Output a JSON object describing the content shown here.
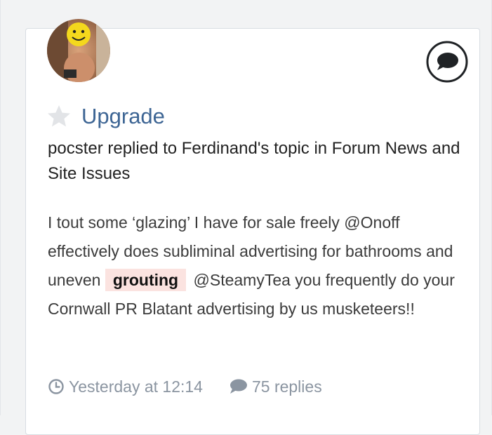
{
  "activity": {
    "title": "Upgrade",
    "subtitle": "pocster replied to Ferdinand's topic in Forum News and Site Issues",
    "excerpt": {
      "before": "I tout some ‘glazing’ I have for sale freely @Onoff effectively does subliminal advertising for bathrooms and uneven",
      "highlight": "grouting",
      "after": "@SteamyTea you frequently do your Cornwall PR Blatant advertising by us musketeers!!"
    },
    "meta": {
      "time": "Yesterday at 12:14",
      "replies": "75 replies"
    }
  },
  "icons": {
    "star": "star-icon",
    "comment": "speech-bubble-icon",
    "clock": "clock-icon",
    "replies": "comment-icon"
  },
  "colors": {
    "link": "#3d6594",
    "meta": "#8b95a1",
    "highlight_bg": "#fbe3e0"
  }
}
